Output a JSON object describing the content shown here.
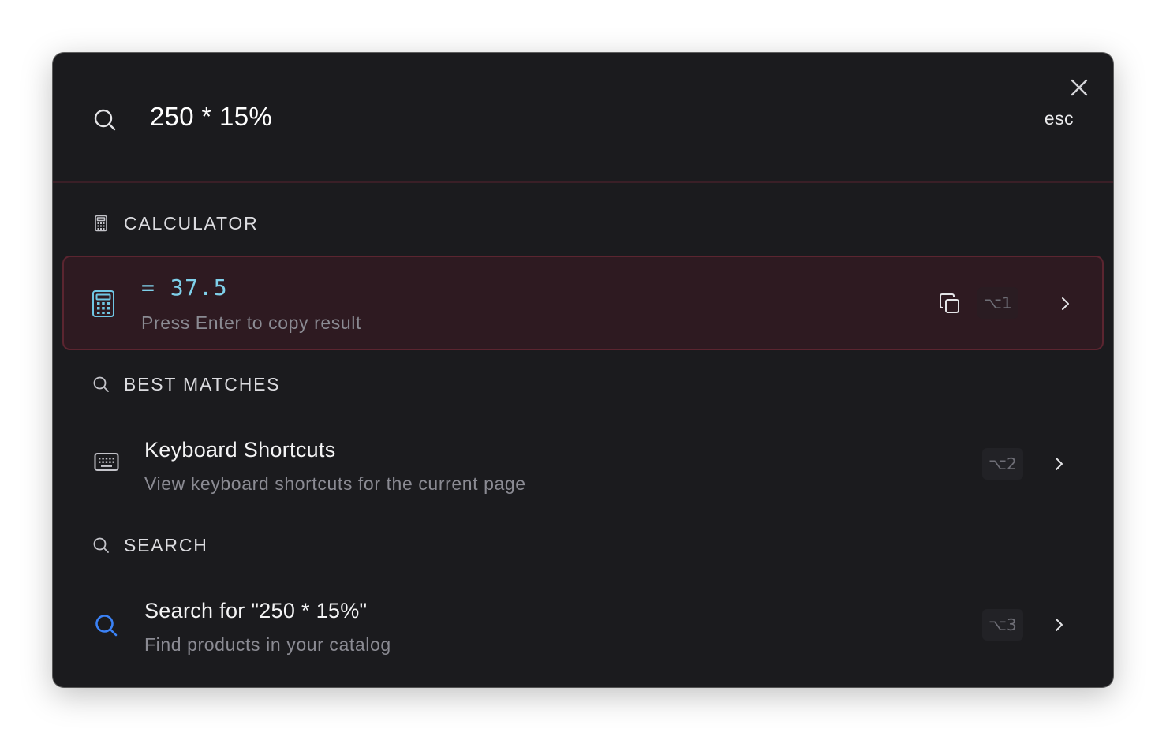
{
  "search": {
    "query": "250 * 15%",
    "esc_label": "esc"
  },
  "sections": {
    "calculator": "CALCULATOR",
    "best_matches": "BEST MATCHES",
    "search": "SEARCH"
  },
  "results": {
    "calculator": {
      "value": "= 37.5",
      "subtitle": "Press Enter to copy result",
      "shortcut": "⌥1",
      "icon": "calculator-icon"
    },
    "keyboard_shortcuts": {
      "title": "Keyboard Shortcuts",
      "subtitle": "View keyboard shortcuts for the current page",
      "shortcut": "⌥2",
      "icon": "keyboard-icon"
    },
    "search_for": {
      "title": "Search for \"250 * 15%\"",
      "subtitle": "Find products in your catalog",
      "shortcut": "⌥3",
      "icon": "search-icon"
    }
  },
  "colors": {
    "background": "#1b1b1e",
    "active_row": "#2e1a21",
    "active_border": "#5b2530",
    "accent_cyan": "#7fd0ea",
    "accent_blue": "#3b82f6"
  }
}
